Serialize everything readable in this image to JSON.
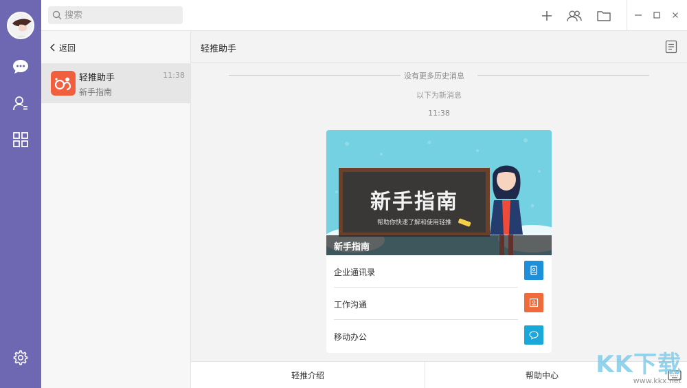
{
  "search": {
    "placeholder": "搜索"
  },
  "list": {
    "back_label": "返回",
    "conversation": {
      "name": "轻推助手",
      "subtitle": "新手指南",
      "time": "11:38"
    }
  },
  "chat": {
    "title": "轻推助手",
    "no_history": "没有更多历史消息",
    "new_messages": "以下为新消息",
    "time": "11:38",
    "card": {
      "banner_title": "新手指南",
      "banner_subtitle": "帮助你快速了解和使用轻推",
      "caption": "新手指南",
      "items": [
        {
          "label": "企业通讯录",
          "color": "#1e8fd8"
        },
        {
          "label": "工作沟通",
          "color": "#f06b3c"
        },
        {
          "label": "移动办公",
          "color": "#1aa7d9"
        }
      ]
    },
    "bottom_menu": [
      "轻推介绍",
      "帮助中心"
    ]
  },
  "watermark": {
    "big": "KK下载",
    "small": "www.kkx.net"
  },
  "colors": {
    "rail": "#6e67b1",
    "app_icon": "#f0603e"
  }
}
